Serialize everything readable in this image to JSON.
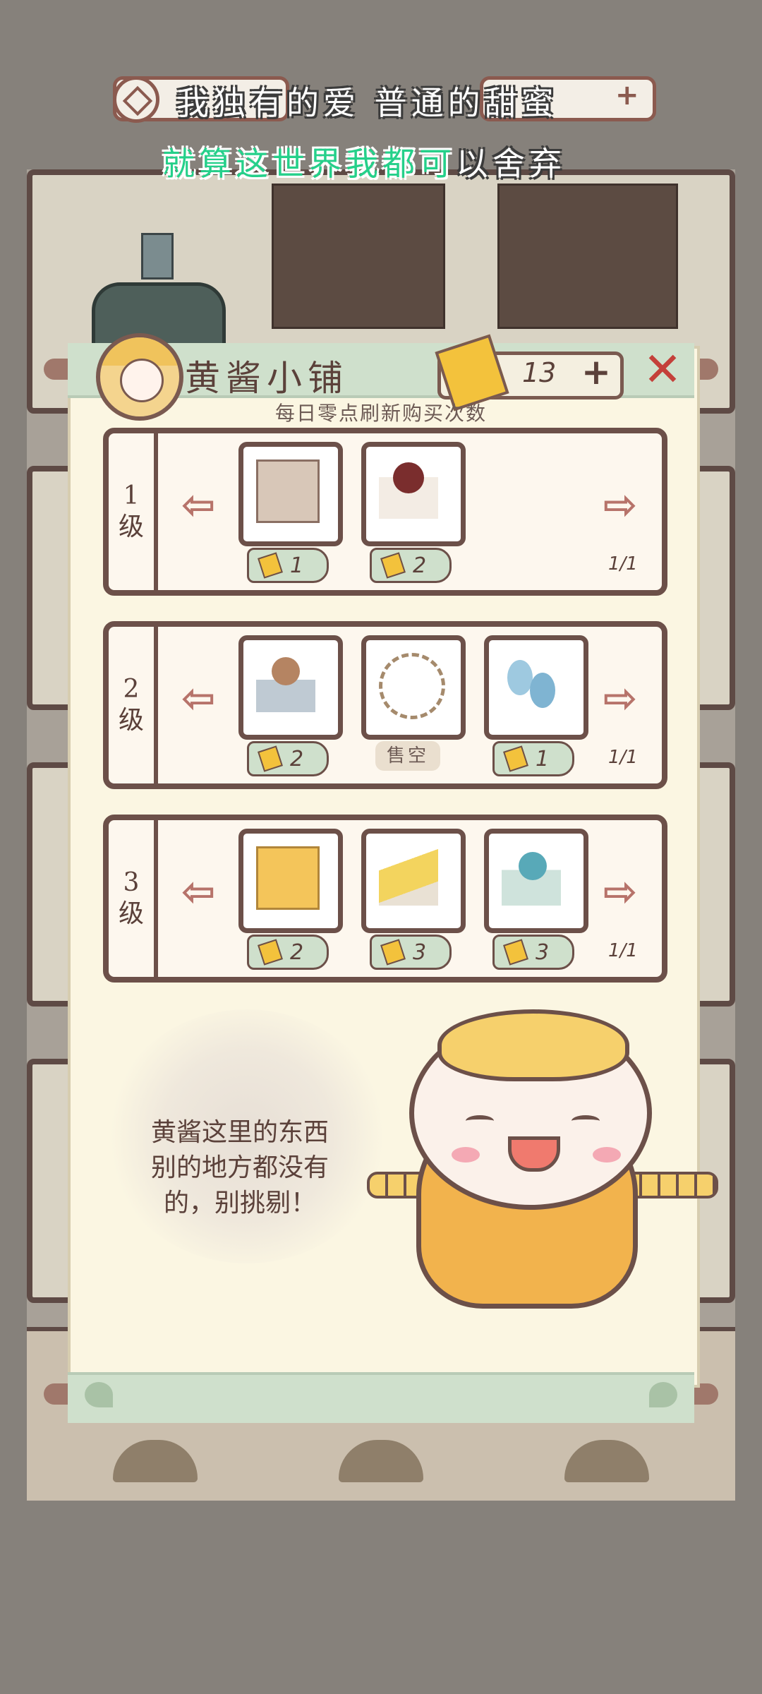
{
  "hud": {
    "lyric_line1": "我独有的爱 普通的甜蜜",
    "lyric_line2_green": "就算这世界我都可",
    "lyric_line2_white": "以舍弃"
  },
  "shop": {
    "title": "黄酱小铺",
    "currency_value": "13",
    "currency_plus": "+",
    "close_label": "✕",
    "subtitle": "每日零点刷新购买次数",
    "tiers": [
      {
        "label_num": "1",
        "label_word": "级",
        "page": "1/1",
        "items": [
          {
            "icon": "paper-bag-item",
            "price": "1"
          },
          {
            "icon": "red-ball-on-cloth-item",
            "price": "2"
          }
        ]
      },
      {
        "label_num": "2",
        "label_word": "级",
        "page": "1/1",
        "items": [
          {
            "icon": "brown-ball-on-mat-item",
            "price": "2"
          },
          {
            "icon": "coiled-rope-item",
            "status": "售空"
          },
          {
            "icon": "blue-gourds-item",
            "price": "1"
          }
        ]
      },
      {
        "label_num": "3",
        "label_word": "级",
        "page": "1/1",
        "items": [
          {
            "icon": "golden-bag-item",
            "price": "2"
          },
          {
            "icon": "gold-cloth-item",
            "price": "3"
          },
          {
            "icon": "teal-ball-on-cloth-item",
            "price": "3"
          }
        ]
      }
    ],
    "speech_line1": "黄酱这里的东西",
    "speech_line2": "别的地方都没有",
    "speech_line3": "的，别挑剔！"
  },
  "colors": {
    "currency_gold": "#f3c23c",
    "close_red": "#c4403a",
    "lyric_green": "#25d08a",
    "panel_bg": "#fbf6e2",
    "frame_brown": "#6c5049"
  }
}
